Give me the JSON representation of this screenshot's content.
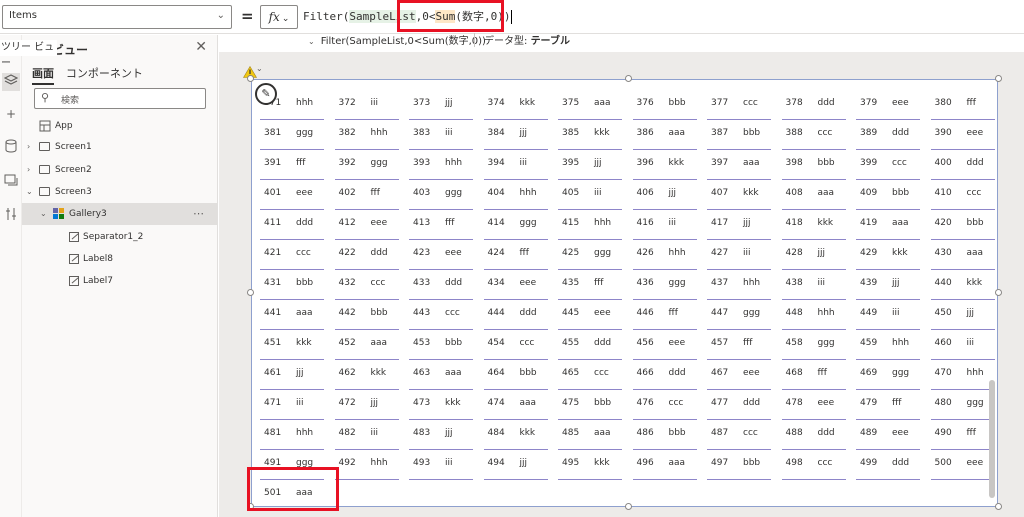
{
  "formula_bar": {
    "property": "Items",
    "fx_label": "fx",
    "formula_prefix": "Filter(",
    "formula_arg1": "SampleList",
    "formula_mid": ",0<",
    "formula_func": "Sum",
    "formula_rest": "(数字,0))",
    "hint_expression": "Filter(SampleList,0<Sum(数字,0))",
    "hint_type_label": "データ型:",
    "hint_type_value": "テーブル"
  },
  "rail": {
    "tooltip": "ツリー ビュー",
    "icons": [
      "layers-icon",
      "plus-icon",
      "database-icon",
      "media-icon",
      "tools-icon"
    ]
  },
  "tree": {
    "title": "ビュー",
    "tabs": [
      "画面",
      "コンポーネント"
    ],
    "search_placeholder": "検索",
    "items": [
      {
        "label": "App"
      },
      {
        "label": "Screen1"
      },
      {
        "label": "Screen2"
      },
      {
        "label": "Screen3"
      },
      {
        "label": "Gallery3"
      },
      {
        "label": "Separator1_2"
      },
      {
        "label": "Label8"
      },
      {
        "label": "Label7"
      }
    ]
  },
  "gallery": {
    "rows": [
      [
        [
          "371",
          "hhh"
        ],
        [
          "372",
          "iii"
        ],
        [
          "373",
          "jjj"
        ],
        [
          "374",
          "kkk"
        ],
        [
          "375",
          "aaa"
        ],
        [
          "376",
          "bbb"
        ],
        [
          "377",
          "ccc"
        ],
        [
          "378",
          "ddd"
        ],
        [
          "379",
          "eee"
        ],
        [
          "380",
          "fff"
        ]
      ],
      [
        [
          "381",
          "ggg"
        ],
        [
          "382",
          "hhh"
        ],
        [
          "383",
          "iii"
        ],
        [
          "384",
          "jjj"
        ],
        [
          "385",
          "kkk"
        ],
        [
          "386",
          "aaa"
        ],
        [
          "387",
          "bbb"
        ],
        [
          "388",
          "ccc"
        ],
        [
          "389",
          "ddd"
        ],
        [
          "390",
          "eee"
        ]
      ],
      [
        [
          "391",
          "fff"
        ],
        [
          "392",
          "ggg"
        ],
        [
          "393",
          "hhh"
        ],
        [
          "394",
          "iii"
        ],
        [
          "395",
          "jjj"
        ],
        [
          "396",
          "kkk"
        ],
        [
          "397",
          "aaa"
        ],
        [
          "398",
          "bbb"
        ],
        [
          "399",
          "ccc"
        ],
        [
          "400",
          "ddd"
        ]
      ],
      [
        [
          "401",
          "eee"
        ],
        [
          "402",
          "fff"
        ],
        [
          "403",
          "ggg"
        ],
        [
          "404",
          "hhh"
        ],
        [
          "405",
          "iii"
        ],
        [
          "406",
          "jjj"
        ],
        [
          "407",
          "kkk"
        ],
        [
          "408",
          "aaa"
        ],
        [
          "409",
          "bbb"
        ],
        [
          "410",
          "ccc"
        ]
      ],
      [
        [
          "411",
          "ddd"
        ],
        [
          "412",
          "eee"
        ],
        [
          "413",
          "fff"
        ],
        [
          "414",
          "ggg"
        ],
        [
          "415",
          "hhh"
        ],
        [
          "416",
          "iii"
        ],
        [
          "417",
          "jjj"
        ],
        [
          "418",
          "kkk"
        ],
        [
          "419",
          "aaa"
        ],
        [
          "420",
          "bbb"
        ]
      ],
      [
        [
          "421",
          "ccc"
        ],
        [
          "422",
          "ddd"
        ],
        [
          "423",
          "eee"
        ],
        [
          "424",
          "fff"
        ],
        [
          "425",
          "ggg"
        ],
        [
          "426",
          "hhh"
        ],
        [
          "427",
          "iii"
        ],
        [
          "428",
          "jjj"
        ],
        [
          "429",
          "kkk"
        ],
        [
          "430",
          "aaa"
        ]
      ],
      [
        [
          "431",
          "bbb"
        ],
        [
          "432",
          "ccc"
        ],
        [
          "433",
          "ddd"
        ],
        [
          "434",
          "eee"
        ],
        [
          "435",
          "fff"
        ],
        [
          "436",
          "ggg"
        ],
        [
          "437",
          "hhh"
        ],
        [
          "438",
          "iii"
        ],
        [
          "439",
          "jjj"
        ],
        [
          "440",
          "kkk"
        ]
      ],
      [
        [
          "441",
          "aaa"
        ],
        [
          "442",
          "bbb"
        ],
        [
          "443",
          "ccc"
        ],
        [
          "444",
          "ddd"
        ],
        [
          "445",
          "eee"
        ],
        [
          "446",
          "fff"
        ],
        [
          "447",
          "ggg"
        ],
        [
          "448",
          "hhh"
        ],
        [
          "449",
          "iii"
        ],
        [
          "450",
          "jjj"
        ]
      ],
      [
        [
          "451",
          "kkk"
        ],
        [
          "452",
          "aaa"
        ],
        [
          "453",
          "bbb"
        ],
        [
          "454",
          "ccc"
        ],
        [
          "455",
          "ddd"
        ],
        [
          "456",
          "eee"
        ],
        [
          "457",
          "fff"
        ],
        [
          "458",
          "ggg"
        ],
        [
          "459",
          "hhh"
        ],
        [
          "460",
          "iii"
        ]
      ],
      [
        [
          "461",
          "jjj"
        ],
        [
          "462",
          "kkk"
        ],
        [
          "463",
          "aaa"
        ],
        [
          "464",
          "bbb"
        ],
        [
          "465",
          "ccc"
        ],
        [
          "466",
          "ddd"
        ],
        [
          "467",
          "eee"
        ],
        [
          "468",
          "fff"
        ],
        [
          "469",
          "ggg"
        ],
        [
          "470",
          "hhh"
        ]
      ],
      [
        [
          "471",
          "iii"
        ],
        [
          "472",
          "jjj"
        ],
        [
          "473",
          "kkk"
        ],
        [
          "474",
          "aaa"
        ],
        [
          "475",
          "bbb"
        ],
        [
          "476",
          "ccc"
        ],
        [
          "477",
          "ddd"
        ],
        [
          "478",
          "eee"
        ],
        [
          "479",
          "fff"
        ],
        [
          "480",
          "ggg"
        ]
      ],
      [
        [
          "481",
          "hhh"
        ],
        [
          "482",
          "iii"
        ],
        [
          "483",
          "jjj"
        ],
        [
          "484",
          "kkk"
        ],
        [
          "485",
          "aaa"
        ],
        [
          "486",
          "bbb"
        ],
        [
          "487",
          "ccc"
        ],
        [
          "488",
          "ddd"
        ],
        [
          "489",
          "eee"
        ],
        [
          "490",
          "fff"
        ]
      ],
      [
        [
          "491",
          "ggg"
        ],
        [
          "492",
          "hhh"
        ],
        [
          "493",
          "iii"
        ],
        [
          "494",
          "jjj"
        ],
        [
          "495",
          "kkk"
        ],
        [
          "496",
          "aaa"
        ],
        [
          "497",
          "bbb"
        ],
        [
          "498",
          "ccc"
        ],
        [
          "499",
          "ddd"
        ],
        [
          "500",
          "eee"
        ]
      ],
      [
        [
          "501",
          "aaa"
        ]
      ]
    ]
  },
  "colors": {
    "highlight_red": "#e81123",
    "separator": "#8d85c9",
    "selection": "#8ea0ce"
  }
}
